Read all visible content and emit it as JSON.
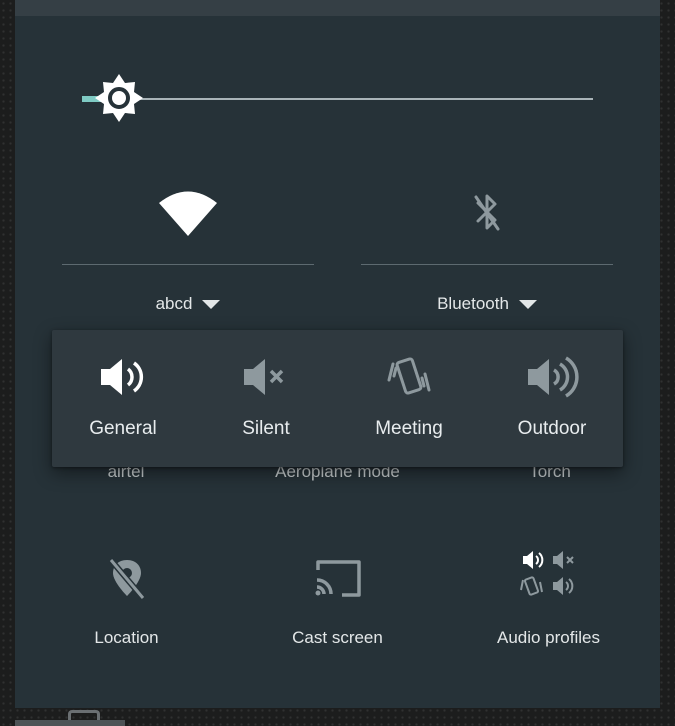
{
  "quick_settings": {
    "brightness_level": 0.04,
    "wifi": {
      "network": "abcd",
      "state": "on"
    },
    "bluetooth": {
      "label": "Bluetooth",
      "state": "off"
    },
    "hidden_row": [
      "airtel",
      "Aeroplane mode",
      "Torch"
    ],
    "tiles": [
      {
        "label": "Location",
        "icon": "location-off-icon"
      },
      {
        "label": "Cast screen",
        "icon": "cast-icon"
      },
      {
        "label": "Audio profiles",
        "icon": "audio-profiles-icon"
      }
    ]
  },
  "audio_profiles_popup": {
    "options": [
      {
        "label": "General",
        "icon": "speaker-icon",
        "selected": true
      },
      {
        "label": "Silent",
        "icon": "mute-icon",
        "selected": false
      },
      {
        "label": "Meeting",
        "icon": "vibrate-icon",
        "selected": false
      },
      {
        "label": "Outdoor",
        "icon": "loud-speaker-icon",
        "selected": false
      }
    ]
  },
  "colors": {
    "panel": "#263238",
    "accent": "#7fcbc4",
    "popup": "#2f393f",
    "text": "#e3e7e8"
  }
}
